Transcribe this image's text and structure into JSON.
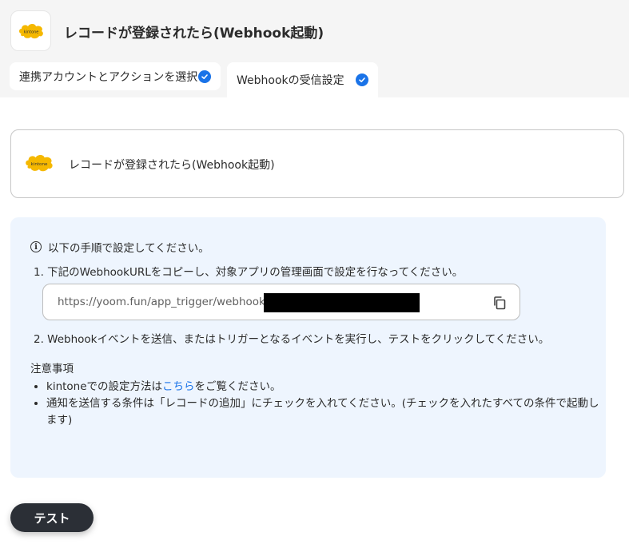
{
  "header": {
    "title": "レコードが登録されたら(Webhook起動)",
    "logo_icon": "kintone-logo-icon"
  },
  "tabs": [
    {
      "label": "連携アカウントとアクションを選択",
      "completed": true
    },
    {
      "label": "Webhookの受信設定",
      "completed": true,
      "active": true
    }
  ],
  "trigger_card": {
    "title": "レコードが登録されたら(Webhook起動)",
    "logo_icon": "kintone-logo-icon"
  },
  "instructions": {
    "heading": "以下の手順で設定してください。",
    "step1": "1. 下記のWebhookURLをコピーし、対象アプリの管理画面で設定を行なってください。",
    "webhook_url": "https://yoom.fun/app_trigger/webhooks",
    "step2": "2. Webhookイベントを送信、またはトリガーとなるイベントを実行し、テストをクリックしてください。"
  },
  "notes": {
    "title": "注意事項",
    "item1_prefix": "kintoneでの設定方法は",
    "item1_link": "こちら",
    "item1_suffix": "をご覧ください。",
    "item2": "通知を送信する条件は「レコードの追加」にチェックを入れてください。(チェックを入れたすべての条件で起動します)"
  },
  "actions": {
    "test_label": "テスト"
  },
  "colors": {
    "accent": "#1a73e8",
    "panel": "#eef5fe",
    "kintone": "#f5b800"
  }
}
